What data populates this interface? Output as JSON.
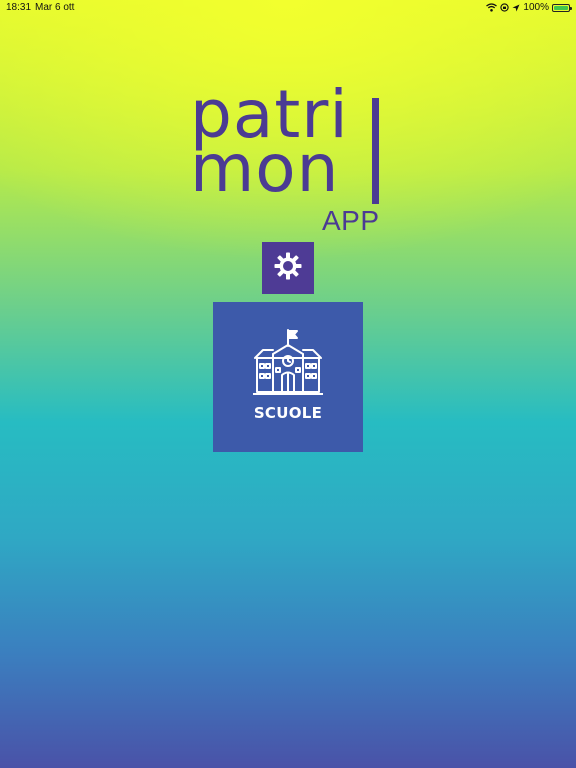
{
  "status_bar": {
    "time": "18:31",
    "date": "Mar 6 ott",
    "battery_percent": "100%",
    "icons": [
      "wifi-icon",
      "screen-lock-icon",
      "location-icon",
      "battery-icon"
    ]
  },
  "logo": {
    "line1": "patri",
    "line2": "mon",
    "sub": "APP",
    "color": "#4b3b93"
  },
  "settings": {
    "icon": "gear-icon",
    "color": "#4e3b95"
  },
  "tiles": [
    {
      "label": "SCUOLE",
      "icon": "school-building-icon",
      "color": "#3d5aaa"
    }
  ]
}
